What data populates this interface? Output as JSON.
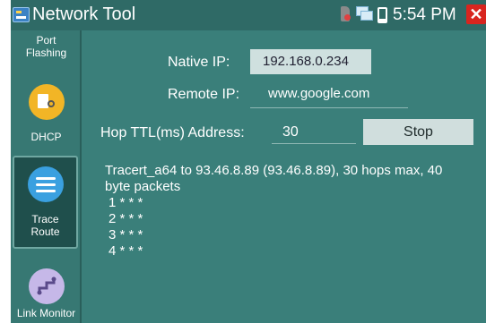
{
  "window": {
    "title": "Network Tool",
    "time": "5:54 PM",
    "close_label": "✕"
  },
  "sidebar": {
    "items": [
      {
        "label_line1": "Port",
        "label_line2": "Flashing"
      },
      {
        "label": "DHCP"
      },
      {
        "label_line1": "Trace",
        "label_line2": "Route"
      },
      {
        "label": "Link Monitor"
      }
    ]
  },
  "form": {
    "native_ip_label": "Native IP:",
    "native_ip_value": "192.168.0.234",
    "remote_ip_label": "Remote IP:",
    "remote_ip_value": "www.google.com",
    "hop_label": "Hop TTL(ms) Address:",
    "hop_value": "30",
    "stop_label": "Stop"
  },
  "output": {
    "header_line1": "Tracert_a64 to 93.46.8.89 (93.46.8.89), 30 hops max, 40",
    "header_line2": "byte packets",
    "hops": [
      "1 * * *",
      "2 * * *",
      "3 * * *",
      "4 * * *"
    ]
  },
  "colors": {
    "background": "#3a7f7a",
    "titlebar": "#2f6a66",
    "close": "#d8251f",
    "selected_item": "#1f4f4c"
  },
  "icons": {
    "app": "network-tool-app-icon",
    "sd": "sd-card-icon",
    "network": "network-connection-icon",
    "battery": "battery-icon",
    "dhcp": "dhcp-server-icon",
    "trace": "trace-route-icon",
    "link": "link-monitor-icon"
  }
}
